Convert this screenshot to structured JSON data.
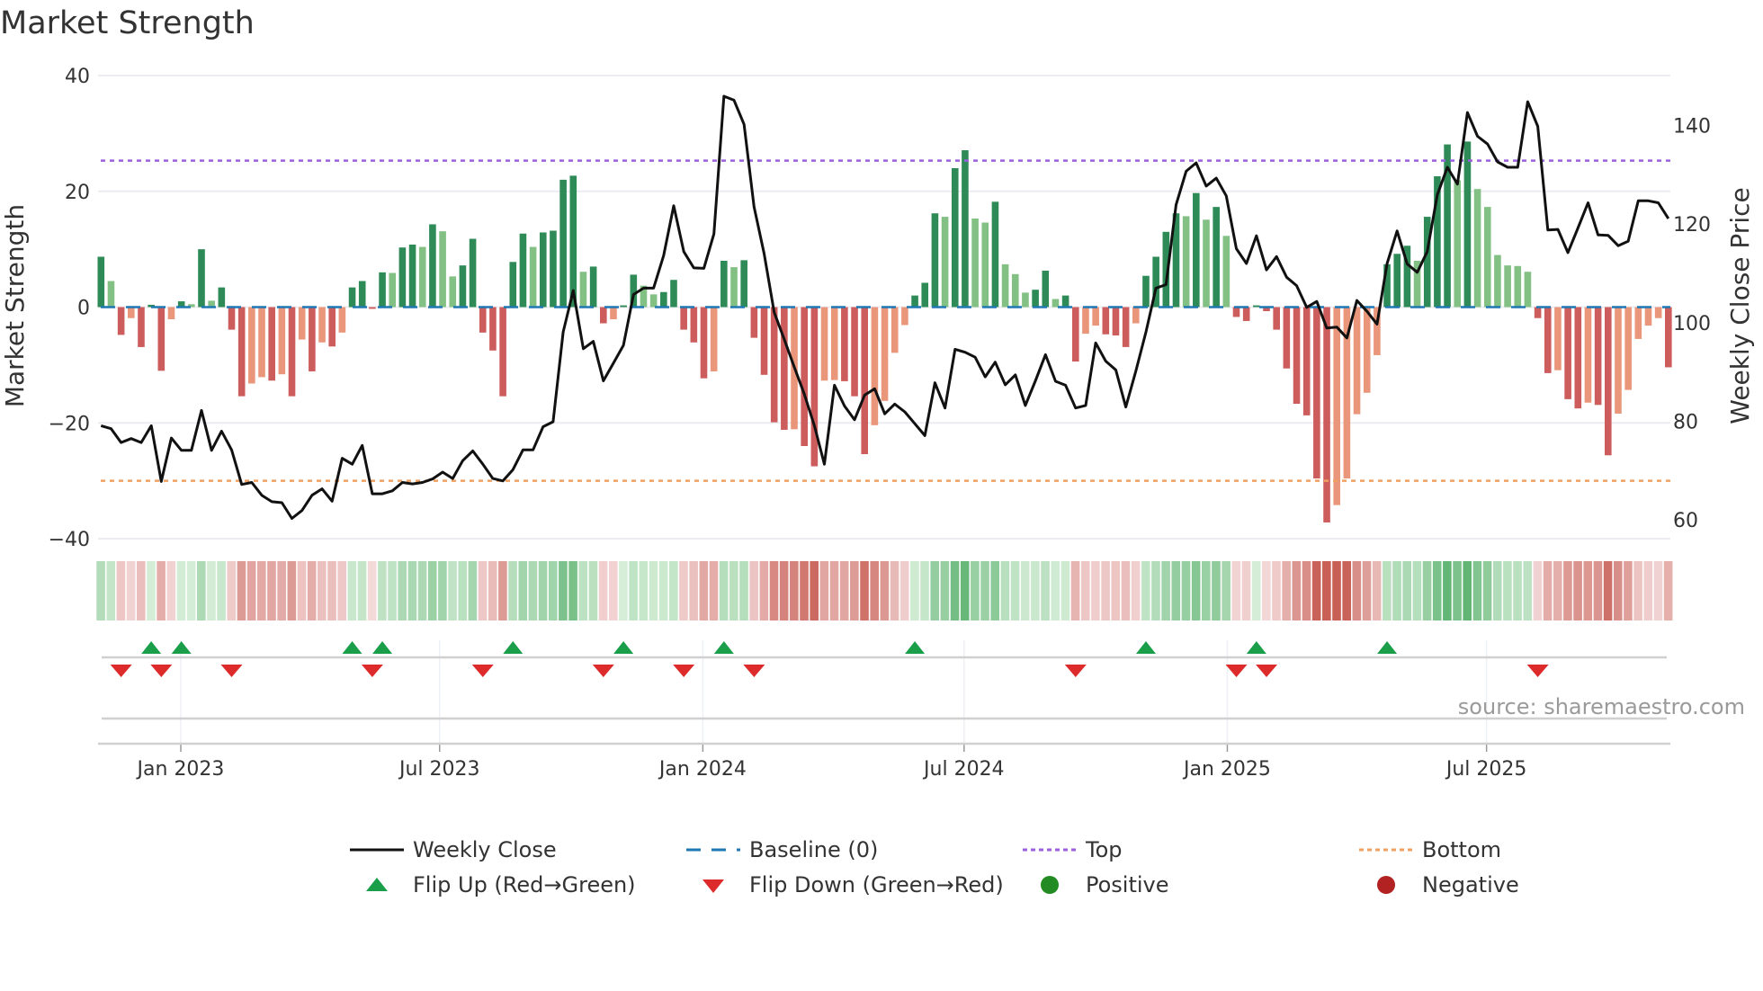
{
  "title": "Market Strength",
  "source": "source: sharemaestro.com",
  "legend": {
    "weekly_close": "Weekly Close",
    "baseline": "Baseline (0)",
    "top": "Top",
    "bottom": "Bottom",
    "flip_up": "Flip Up (Red→Green)",
    "flip_down": "Flip Down (Green→Red)",
    "positive": "Positive",
    "negative": "Negative"
  },
  "colors": {
    "pos_rising": "#2e8b57",
    "pos_falling": "#82c084",
    "neg_falling": "#cd5c5c",
    "neg_rising": "#e9967a",
    "price_line": "#111111",
    "baseline": "#1f77b4",
    "top": "#9b5fe0",
    "bottom": "#f0a060",
    "flip_up": "#1a9e4a",
    "flip_down": "#dd2a2a",
    "positive_dot": "#228b22",
    "negative_dot": "#b22222"
  },
  "chart_data": {
    "type": "bar",
    "title": "Market Strength",
    "ylabel": "Market Strength",
    "y2label": "Weekly Close Price",
    "ylim": [
      -40,
      40
    ],
    "y2lim": [
      56.2,
      150.1
    ],
    "y_ticks": [
      {
        "v": 40,
        "label": "40"
      },
      {
        "v": 20,
        "label": "20"
      },
      {
        "v": 0,
        "label": "0"
      },
      {
        "v": -20,
        "label": "−20"
      },
      {
        "v": -40,
        "label": "−40"
      }
    ],
    "y2_ticks": [
      {
        "v": 140,
        "label": "140"
      },
      {
        "v": 120,
        "label": "120"
      },
      {
        "v": 100,
        "label": "100"
      },
      {
        "v": 80,
        "label": "80"
      },
      {
        "v": 60,
        "label": "60"
      }
    ],
    "x_ticks": [
      {
        "week": 7.94,
        "label": "Jan 2023"
      },
      {
        "week": 33.7,
        "label": "Jul 2023"
      },
      {
        "week": 59.9,
        "label": "Jan 2024"
      },
      {
        "week": 85.9,
        "label": "Jul 2024"
      },
      {
        "week": 112.1,
        "label": "Jan 2025"
      },
      {
        "week": 137.9,
        "label": "Jul 2025"
      }
    ],
    "top_level": 25.3,
    "bottom_level": -30.0,
    "baseline": 0,
    "strength": [
      8.7,
      4.5,
      -4.8,
      -1.9,
      -6.9,
      0.4,
      -11,
      -2.1,
      1,
      0.5,
      10,
      1.1,
      3.4,
      -3.9,
      -15.4,
      -13.2,
      -12.1,
      -12.7,
      -11.6,
      -15.4,
      -5.6,
      -11.1,
      -6.1,
      -6.8,
      -4.4,
      3.4,
      4.5,
      -0.3,
      6,
      5.9,
      10.3,
      10.8,
      10.4,
      14.3,
      13.1,
      5.3,
      7.2,
      11.8,
      -4.4,
      -7.5,
      -15.4,
      7.8,
      12.7,
      10.4,
      12.9,
      13.2,
      22.0,
      22.7,
      6.1,
      7.0,
      -2.8,
      -2.1,
      0.3,
      5.6,
      3.7,
      2.2,
      2.6,
      4.7,
      -3.9,
      -6.1,
      -12.3,
      -11.1,
      8.0,
      6.9,
      8.1,
      -5.3,
      -11.7,
      -19.9,
      -21.2,
      -21.1,
      -24.0,
      -27.5,
      -12.7,
      -12.6,
      -12.8,
      -15.4,
      -25.4,
      -20.4,
      -16.2,
      -7.9,
      -3.1,
      2.0,
      4.2,
      16.2,
      15.6,
      24.0,
      27.1,
      15.3,
      14.6,
      18.2,
      7.4,
      5.7,
      2.5,
      3.0,
      6.3,
      1.4,
      2.0,
      -9.4,
      -4.6,
      -3.2,
      -4.7,
      -4.9,
      -6.9,
      -2.8,
      5.4,
      8.7,
      13.0,
      16.2,
      15.7,
      19.7,
      15.1,
      17.3,
      12.3,
      -1.7,
      -2.4,
      0.3,
      -0.7,
      -3.9,
      -10.6,
      -16.7,
      -18.7,
      -29.6,
      -37.2,
      -34.2,
      -29.6,
      -18.5,
      -14.8,
      -8.3,
      7.4,
      9.2,
      10.6,
      8.0,
      15.6,
      22.6,
      28.1,
      21.9,
      28.6,
      20.4,
      17.3,
      9.0,
      7.2,
      7.1,
      6.1,
      -1.9,
      -11.4,
      -10.9,
      -15.9,
      -17.5,
      -16.5,
      -16.9,
      -25.6,
      -18.4,
      -14.3,
      -5.5,
      -3.2,
      -1.9,
      -10.4
    ],
    "weekly_close": [
      79.1,
      78.5,
      75.7,
      76.5,
      75.7,
      79.1,
      67.8,
      76.6,
      74.1,
      74.1,
      82.2,
      74.1,
      78.0,
      74.2,
      67.2,
      67.6,
      65.0,
      63.7,
      63.5,
      60.3,
      61.9,
      65.0,
      66.3,
      63.8,
      72.5,
      71.3,
      75.1,
      65.3,
      65.3,
      65.9,
      67.6,
      67.3,
      67.6,
      68.3,
      69.7,
      68.4,
      72.0,
      74.0,
      71.3,
      68.4,
      67.9,
      70.2,
      74.2,
      74.2,
      78.9,
      79.9,
      98.1,
      106.5,
      94.7,
      96.2,
      88.2,
      91.8,
      95.4,
      105.7,
      107.0,
      107.0,
      113.6,
      123.7,
      114.4,
      111.1,
      111.0,
      118.0,
      145.9,
      145.1,
      140.2,
      123.5,
      114.0,
      102.1,
      96.6,
      91.0,
      85.5,
      79.1,
      71.3,
      87.3,
      83.1,
      80.3,
      85.3,
      86.6,
      81.5,
      83.5,
      81.9,
      79.5,
      77.1,
      87.8,
      82.7,
      94.6,
      94.0,
      93.0,
      89.0,
      92.0,
      87.4,
      89.4,
      83.2,
      88.2,
      93.5,
      88.1,
      87.3,
      82.7,
      83.2,
      95.9,
      92.2,
      90.4,
      82.9,
      90.2,
      98.1,
      107.0,
      107.7,
      123.9,
      130.7,
      132.4,
      127.7,
      129.3,
      125.7,
      115.0,
      112.0,
      117.6,
      110.7,
      113.4,
      109.2,
      107.5,
      103.1,
      104.3,
      98.9,
      99.1,
      96.9,
      104.5,
      102.3,
      99.7,
      112.0,
      118.6,
      111.9,
      110.2,
      114.4,
      125.9,
      131.5,
      128.1,
      142.6,
      137.8,
      136.2,
      132.6,
      131.5,
      131.5,
      144.8,
      139.8,
      118.8,
      118.9,
      114.2,
      119.2,
      124.3,
      117.8,
      117.7,
      115.6,
      116.5,
      124.7,
      124.7,
      124.3,
      121.1
    ]
  }
}
